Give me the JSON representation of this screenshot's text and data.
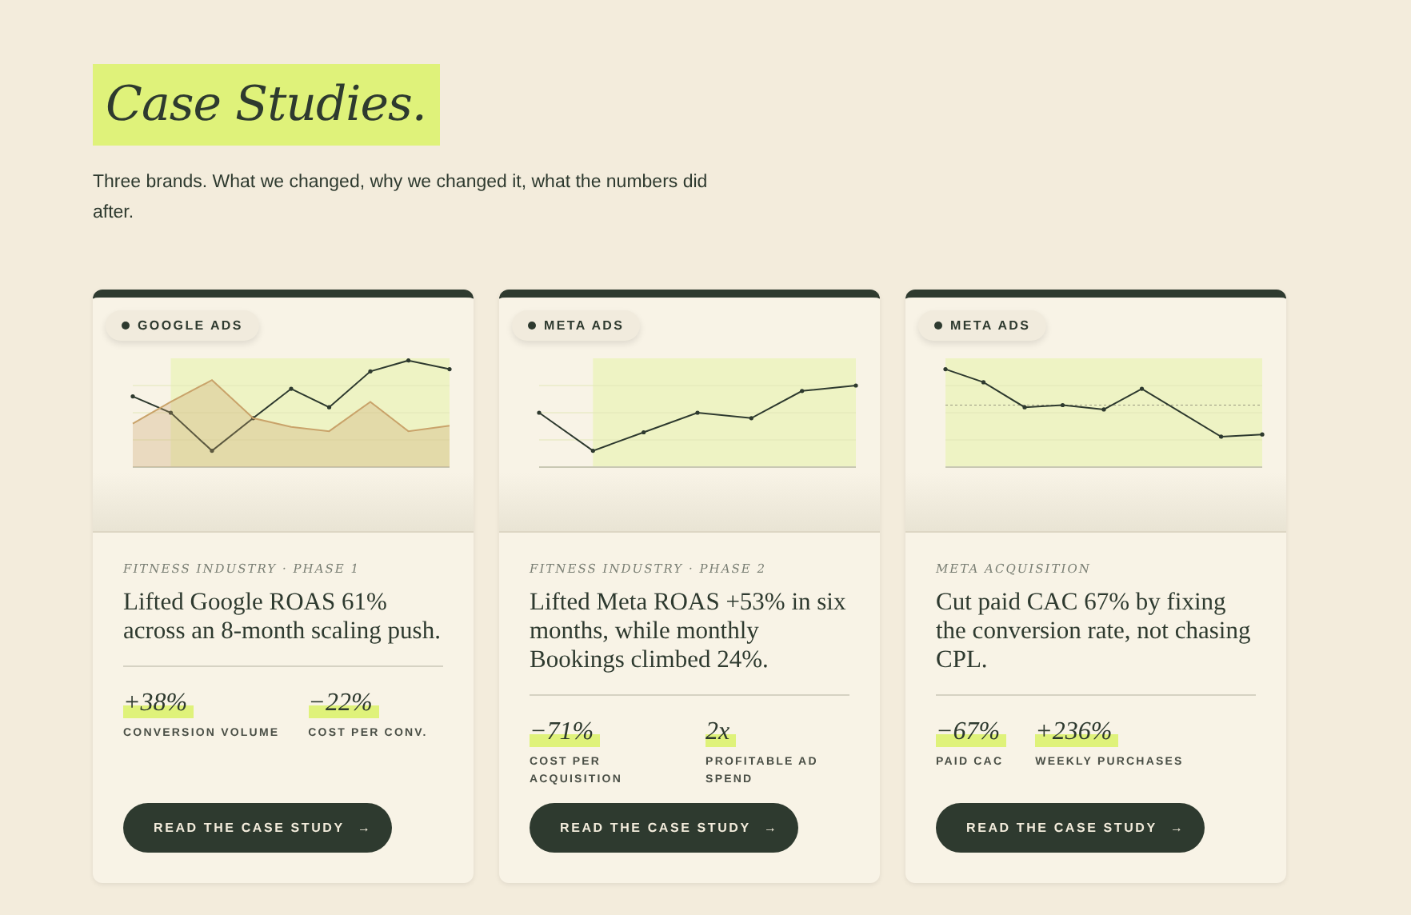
{
  "header": {
    "title": "Case Studies.",
    "subtitle": "Three brands. What we changed, why we changed it, what the numbers did after."
  },
  "cards": [
    {
      "tag": "GOOGLE ADS",
      "category": "FITNESS INDUSTRY · PHASE 1",
      "headline": "Lifted Google ROAS 61% across an 8-month scaling push.",
      "stats": [
        {
          "value": "+38%",
          "label": "CONVERSION VOLUME"
        },
        {
          "value": "−22%",
          "label": "COST PER CONV."
        }
      ],
      "button": "READ THE CASE STUDY",
      "button_icon": "→"
    },
    {
      "tag": "META ADS",
      "category": "FITNESS INDUSTRY · PHASE 2",
      "headline": "Lifted Meta ROAS +53% in six months, while monthly Bookings climbed 24%.",
      "stats": [
        {
          "value": "−71%",
          "label": "COST PER ACQUISITION"
        },
        {
          "value": "2x",
          "label": "PROFITABLE AD SPEND"
        }
      ],
      "button": "READ THE CASE STUDY",
      "button_icon": "→"
    },
    {
      "tag": "META ADS",
      "category": "META ACQUISITION",
      "headline": "Cut paid CAC 67% by fixing the conversion rate, not chasing CPL.",
      "stats": [
        {
          "value": "−67%",
          "label": "PAID CAC"
        },
        {
          "value": "+236%",
          "label": "WEEKLY PURCHASES"
        }
      ],
      "button": "READ THE CASE STUDY",
      "button_icon": "→"
    }
  ]
}
